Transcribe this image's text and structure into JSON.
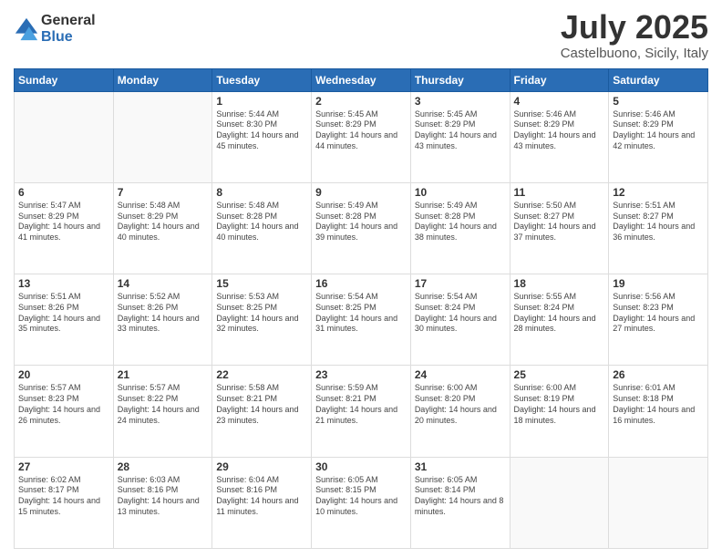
{
  "logo": {
    "general": "General",
    "blue": "Blue"
  },
  "title": "July 2025",
  "location": "Castelbuono, Sicily, Italy",
  "weekdays": [
    "Sunday",
    "Monday",
    "Tuesday",
    "Wednesday",
    "Thursday",
    "Friday",
    "Saturday"
  ],
  "weeks": [
    [
      {
        "day": "",
        "sunrise": "",
        "sunset": "",
        "daylight": ""
      },
      {
        "day": "",
        "sunrise": "",
        "sunset": "",
        "daylight": ""
      },
      {
        "day": "1",
        "sunrise": "Sunrise: 5:44 AM",
        "sunset": "Sunset: 8:30 PM",
        "daylight": "Daylight: 14 hours and 45 minutes."
      },
      {
        "day": "2",
        "sunrise": "Sunrise: 5:45 AM",
        "sunset": "Sunset: 8:29 PM",
        "daylight": "Daylight: 14 hours and 44 minutes."
      },
      {
        "day": "3",
        "sunrise": "Sunrise: 5:45 AM",
        "sunset": "Sunset: 8:29 PM",
        "daylight": "Daylight: 14 hours and 43 minutes."
      },
      {
        "day": "4",
        "sunrise": "Sunrise: 5:46 AM",
        "sunset": "Sunset: 8:29 PM",
        "daylight": "Daylight: 14 hours and 43 minutes."
      },
      {
        "day": "5",
        "sunrise": "Sunrise: 5:46 AM",
        "sunset": "Sunset: 8:29 PM",
        "daylight": "Daylight: 14 hours and 42 minutes."
      }
    ],
    [
      {
        "day": "6",
        "sunrise": "Sunrise: 5:47 AM",
        "sunset": "Sunset: 8:29 PM",
        "daylight": "Daylight: 14 hours and 41 minutes."
      },
      {
        "day": "7",
        "sunrise": "Sunrise: 5:48 AM",
        "sunset": "Sunset: 8:29 PM",
        "daylight": "Daylight: 14 hours and 40 minutes."
      },
      {
        "day": "8",
        "sunrise": "Sunrise: 5:48 AM",
        "sunset": "Sunset: 8:28 PM",
        "daylight": "Daylight: 14 hours and 40 minutes."
      },
      {
        "day": "9",
        "sunrise": "Sunrise: 5:49 AM",
        "sunset": "Sunset: 8:28 PM",
        "daylight": "Daylight: 14 hours and 39 minutes."
      },
      {
        "day": "10",
        "sunrise": "Sunrise: 5:49 AM",
        "sunset": "Sunset: 8:28 PM",
        "daylight": "Daylight: 14 hours and 38 minutes."
      },
      {
        "day": "11",
        "sunrise": "Sunrise: 5:50 AM",
        "sunset": "Sunset: 8:27 PM",
        "daylight": "Daylight: 14 hours and 37 minutes."
      },
      {
        "day": "12",
        "sunrise": "Sunrise: 5:51 AM",
        "sunset": "Sunset: 8:27 PM",
        "daylight": "Daylight: 14 hours and 36 minutes."
      }
    ],
    [
      {
        "day": "13",
        "sunrise": "Sunrise: 5:51 AM",
        "sunset": "Sunset: 8:26 PM",
        "daylight": "Daylight: 14 hours and 35 minutes."
      },
      {
        "day": "14",
        "sunrise": "Sunrise: 5:52 AM",
        "sunset": "Sunset: 8:26 PM",
        "daylight": "Daylight: 14 hours and 33 minutes."
      },
      {
        "day": "15",
        "sunrise": "Sunrise: 5:53 AM",
        "sunset": "Sunset: 8:25 PM",
        "daylight": "Daylight: 14 hours and 32 minutes."
      },
      {
        "day": "16",
        "sunrise": "Sunrise: 5:54 AM",
        "sunset": "Sunset: 8:25 PM",
        "daylight": "Daylight: 14 hours and 31 minutes."
      },
      {
        "day": "17",
        "sunrise": "Sunrise: 5:54 AM",
        "sunset": "Sunset: 8:24 PM",
        "daylight": "Daylight: 14 hours and 30 minutes."
      },
      {
        "day": "18",
        "sunrise": "Sunrise: 5:55 AM",
        "sunset": "Sunset: 8:24 PM",
        "daylight": "Daylight: 14 hours and 28 minutes."
      },
      {
        "day": "19",
        "sunrise": "Sunrise: 5:56 AM",
        "sunset": "Sunset: 8:23 PM",
        "daylight": "Daylight: 14 hours and 27 minutes."
      }
    ],
    [
      {
        "day": "20",
        "sunrise": "Sunrise: 5:57 AM",
        "sunset": "Sunset: 8:23 PM",
        "daylight": "Daylight: 14 hours and 26 minutes."
      },
      {
        "day": "21",
        "sunrise": "Sunrise: 5:57 AM",
        "sunset": "Sunset: 8:22 PM",
        "daylight": "Daylight: 14 hours and 24 minutes."
      },
      {
        "day": "22",
        "sunrise": "Sunrise: 5:58 AM",
        "sunset": "Sunset: 8:21 PM",
        "daylight": "Daylight: 14 hours and 23 minutes."
      },
      {
        "day": "23",
        "sunrise": "Sunrise: 5:59 AM",
        "sunset": "Sunset: 8:21 PM",
        "daylight": "Daylight: 14 hours and 21 minutes."
      },
      {
        "day": "24",
        "sunrise": "Sunrise: 6:00 AM",
        "sunset": "Sunset: 8:20 PM",
        "daylight": "Daylight: 14 hours and 20 minutes."
      },
      {
        "day": "25",
        "sunrise": "Sunrise: 6:00 AM",
        "sunset": "Sunset: 8:19 PM",
        "daylight": "Daylight: 14 hours and 18 minutes."
      },
      {
        "day": "26",
        "sunrise": "Sunrise: 6:01 AM",
        "sunset": "Sunset: 8:18 PM",
        "daylight": "Daylight: 14 hours and 16 minutes."
      }
    ],
    [
      {
        "day": "27",
        "sunrise": "Sunrise: 6:02 AM",
        "sunset": "Sunset: 8:17 PM",
        "daylight": "Daylight: 14 hours and 15 minutes."
      },
      {
        "day": "28",
        "sunrise": "Sunrise: 6:03 AM",
        "sunset": "Sunset: 8:16 PM",
        "daylight": "Daylight: 14 hours and 13 minutes."
      },
      {
        "day": "29",
        "sunrise": "Sunrise: 6:04 AM",
        "sunset": "Sunset: 8:16 PM",
        "daylight": "Daylight: 14 hours and 11 minutes."
      },
      {
        "day": "30",
        "sunrise": "Sunrise: 6:05 AM",
        "sunset": "Sunset: 8:15 PM",
        "daylight": "Daylight: 14 hours and 10 minutes."
      },
      {
        "day": "31",
        "sunrise": "Sunrise: 6:05 AM",
        "sunset": "Sunset: 8:14 PM",
        "daylight": "Daylight: 14 hours and 8 minutes."
      },
      {
        "day": "",
        "sunrise": "",
        "sunset": "",
        "daylight": ""
      },
      {
        "day": "",
        "sunrise": "",
        "sunset": "",
        "daylight": ""
      }
    ]
  ]
}
